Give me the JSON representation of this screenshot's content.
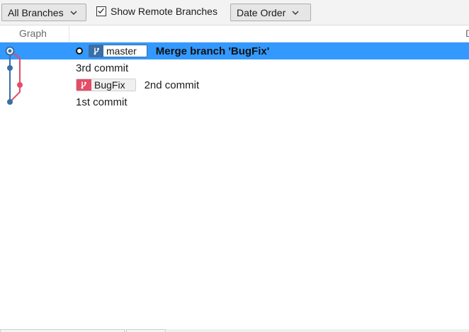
{
  "toolbar": {
    "branch_filter": "All Branches",
    "show_remote_label": "Show Remote Branches",
    "show_remote_checked": true,
    "sort_order": "Date Order"
  },
  "columns": {
    "graph": "Graph",
    "description": "D"
  },
  "commits": [
    {
      "message": "Merge branch 'BugFix'",
      "refs": [
        {
          "name": "master",
          "color": "#3a6ea5",
          "head": true
        }
      ],
      "selected": true
    },
    {
      "message": "3rd commit",
      "refs": []
    },
    {
      "message": "2nd commit",
      "refs": [
        {
          "name": "BugFix",
          "color": "#e44d66"
        }
      ]
    },
    {
      "message": "1st commit",
      "refs": []
    }
  ],
  "colors": {
    "selection": "#3399ff",
    "master_lane": "#3a6ea5",
    "bugfix_lane": "#e44d66"
  }
}
